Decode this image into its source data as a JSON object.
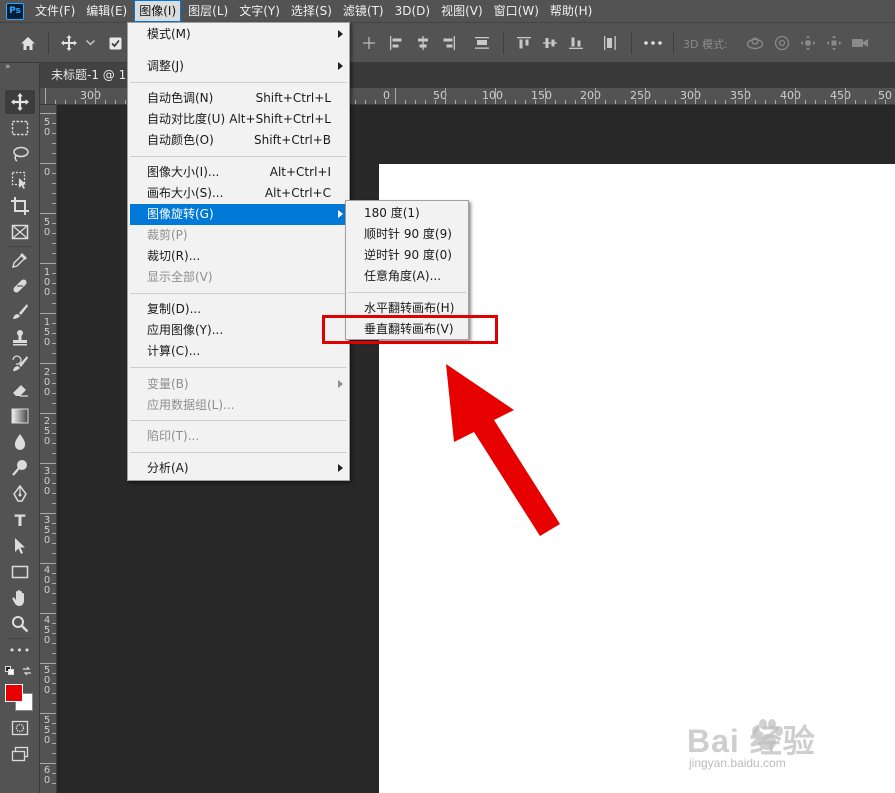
{
  "app": {
    "logo_text": "Ps"
  },
  "menubar": {
    "items": [
      {
        "label": "文件(F)"
      },
      {
        "label": "编辑(E)"
      },
      {
        "label": "图像(I)"
      },
      {
        "label": "图层(L)"
      },
      {
        "label": "文字(Y)"
      },
      {
        "label": "选择(S)"
      },
      {
        "label": "滤镜(T)"
      },
      {
        "label": "3D(D)"
      },
      {
        "label": "视图(V)"
      },
      {
        "label": "窗口(W)"
      },
      {
        "label": "帮助(H)"
      }
    ],
    "active_item": "图像(I)"
  },
  "options_bar": {
    "mode_3d_label": "3D 模式:",
    "icons": [
      "home-icon",
      "move-icon",
      "chevron-down-icon",
      "auto-select-checkbox",
      "transform-controls-icon",
      "align-left-icon",
      "align-center-h-icon",
      "align-right-icon",
      "distribute-icon",
      "align-top-icon",
      "align-center-v-icon",
      "align-bottom-icon",
      "distribute-v-icon",
      "more-icon",
      "orbit-3d-icon",
      "roll-3d-icon",
      "pan-3d-icon",
      "slide-3d-icon",
      "camera-3d-icon"
    ]
  },
  "document_tab": {
    "label": "未标题-1 @ 10"
  },
  "toolbar": {
    "collapse_glyph": "»",
    "tools": [
      "move-tool",
      "marquee-tool",
      "lasso-tool",
      "object-select-tool",
      "crop-tool",
      "frame-tool",
      "eyedropper-tool",
      "healing-brush-tool",
      "brush-tool",
      "clone-stamp-tool",
      "history-brush-tool",
      "eraser-tool",
      "gradient-tool",
      "blur-tool",
      "dodge-tool",
      "pen-tool",
      "type-tool",
      "path-selection-tool",
      "rectangle-tool",
      "hand-tool",
      "zoom-tool",
      "more-tools"
    ],
    "type_tool_glyph": "T",
    "extra_tools_glyph": "•••",
    "foreground_color": "#e60000",
    "background_color": "#ffffff"
  },
  "ruler_top": {
    "labels": [
      "300",
      "0",
      "50",
      "100",
      "150",
      "200",
      "250",
      "300",
      "350",
      "400",
      "450",
      "50"
    ]
  },
  "ruler_left": {
    "labels": [
      "5 0",
      "0",
      "5 0",
      "1 0 0",
      "1 5 0",
      "2 0 0",
      "2 5 0",
      "3 0 0",
      "3 5 0",
      "4 0 0",
      "4 5 0",
      "5 0 0",
      "5 5 0",
      "6 0"
    ]
  },
  "image_menu": {
    "items": [
      {
        "label": "模式(M)",
        "shortcut": "",
        "submenu": true,
        "disabled": false
      },
      {
        "label": "调整(J)",
        "shortcut": "",
        "submenu": true,
        "disabled": false
      },
      {
        "label": "自动色调(N)",
        "shortcut": "Shift+Ctrl+L",
        "submenu": false,
        "disabled": false
      },
      {
        "label": "自动对比度(U)",
        "shortcut": "Alt+Shift+Ctrl+L",
        "submenu": false,
        "disabled": false
      },
      {
        "label": "自动颜色(O)",
        "shortcut": "Shift+Ctrl+B",
        "submenu": false,
        "disabled": false
      },
      {
        "label": "图像大小(I)...",
        "shortcut": "Alt+Ctrl+I",
        "submenu": false,
        "disabled": false
      },
      {
        "label": "画布大小(S)...",
        "shortcut": "Alt+Ctrl+C",
        "submenu": false,
        "disabled": false
      },
      {
        "label": "图像旋转(G)",
        "shortcut": "",
        "submenu": true,
        "disabled": false,
        "highlighted": true
      },
      {
        "label": "裁剪(P)",
        "shortcut": "",
        "submenu": false,
        "disabled": true
      },
      {
        "label": "裁切(R)...",
        "shortcut": "",
        "submenu": false,
        "disabled": false
      },
      {
        "label": "显示全部(V)",
        "shortcut": "",
        "submenu": false,
        "disabled": true
      },
      {
        "label": "复制(D)...",
        "shortcut": "",
        "submenu": false,
        "disabled": false
      },
      {
        "label": "应用图像(Y)...",
        "shortcut": "",
        "submenu": false,
        "disabled": false
      },
      {
        "label": "计算(C)...",
        "shortcut": "",
        "submenu": false,
        "disabled": false
      },
      {
        "label": "变量(B)",
        "shortcut": "",
        "submenu": true,
        "disabled": true
      },
      {
        "label": "应用数据组(L)...",
        "shortcut": "",
        "submenu": false,
        "disabled": true
      },
      {
        "label": "陷印(T)...",
        "shortcut": "",
        "submenu": false,
        "disabled": true
      },
      {
        "label": "分析(A)",
        "shortcut": "",
        "submenu": true,
        "disabled": false
      }
    ]
  },
  "rotate_submenu": {
    "items": [
      {
        "label": "180 度(1)"
      },
      {
        "label": "顺时针 90 度(9)"
      },
      {
        "label": "逆时针 90 度(0)"
      },
      {
        "label": "任意角度(A)..."
      },
      {
        "label": "水平翻转画布(H)"
      },
      {
        "label": "垂直翻转画布(V)"
      }
    ],
    "annotated_item": "垂直翻转画布(V)"
  },
  "annotation": {
    "color": "#e00000"
  },
  "watermark": {
    "brand": "Bai  经验",
    "url": "jingyan.baidu.com"
  }
}
